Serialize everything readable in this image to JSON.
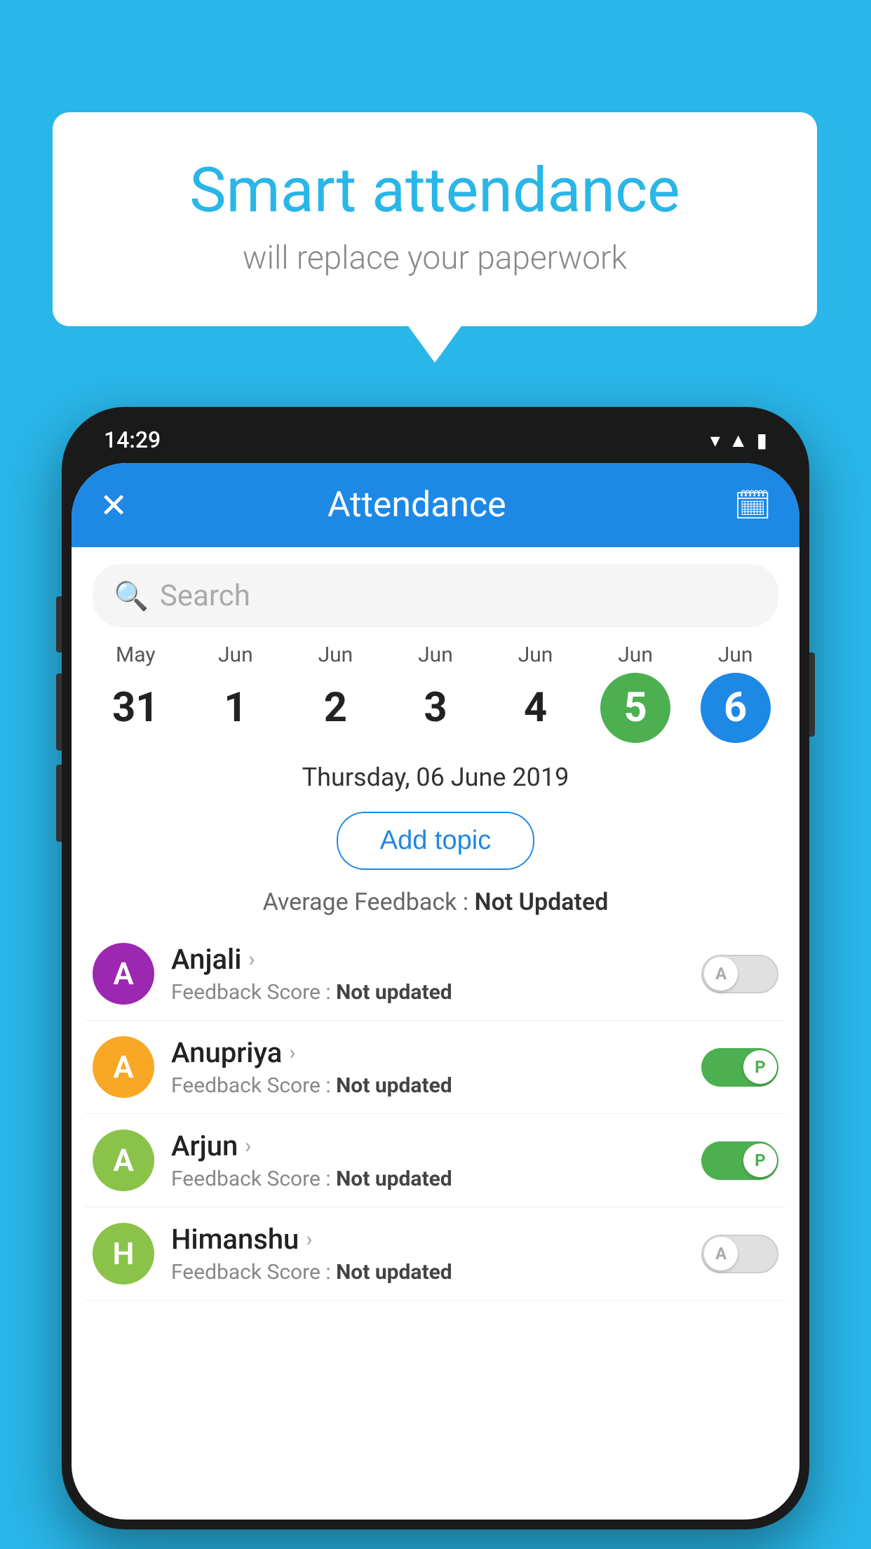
{
  "background_color": "#29b6e8",
  "speech_bubble": {
    "title": "Smart attendance",
    "subtitle": "will replace your paperwork"
  },
  "phone": {
    "status_bar": {
      "time": "14:29",
      "icons": [
        "wifi",
        "signal",
        "battery"
      ]
    },
    "header": {
      "title": "Attendance",
      "close_icon": "✕",
      "calendar_icon": "📅"
    },
    "search": {
      "placeholder": "Search"
    },
    "calendar": {
      "days": [
        {
          "month": "May",
          "date": "31",
          "type": "normal"
        },
        {
          "month": "Jun",
          "date": "1",
          "type": "normal"
        },
        {
          "month": "Jun",
          "date": "2",
          "type": "normal"
        },
        {
          "month": "Jun",
          "date": "3",
          "type": "normal"
        },
        {
          "month": "Jun",
          "date": "4",
          "type": "normal"
        },
        {
          "month": "Jun",
          "date": "5",
          "type": "today"
        },
        {
          "month": "Jun",
          "date": "6",
          "type": "selected"
        }
      ]
    },
    "selected_date": "Thursday, 06 June 2019",
    "add_topic_label": "Add topic",
    "average_feedback_label": "Average Feedback :",
    "average_feedback_value": "Not Updated",
    "students": [
      {
        "name": "Anjali",
        "avatar_letter": "A",
        "avatar_color": "#9c27b0",
        "feedback_label": "Feedback Score :",
        "feedback_value": "Not updated",
        "toggle_state": "off",
        "toggle_label": "A"
      },
      {
        "name": "Anupriya",
        "avatar_letter": "A",
        "avatar_color": "#f9a825",
        "feedback_label": "Feedback Score :",
        "feedback_value": "Not updated",
        "toggle_state": "on",
        "toggle_label": "P"
      },
      {
        "name": "Arjun",
        "avatar_letter": "A",
        "avatar_color": "#8bc34a",
        "feedback_label": "Feedback Score :",
        "feedback_value": "Not updated",
        "toggle_state": "on",
        "toggle_label": "P"
      },
      {
        "name": "Himanshu",
        "avatar_letter": "H",
        "avatar_color": "#8bc34a",
        "feedback_label": "Feedback Score :",
        "feedback_value": "Not updated",
        "toggle_state": "off",
        "toggle_label": "A"
      }
    ]
  }
}
